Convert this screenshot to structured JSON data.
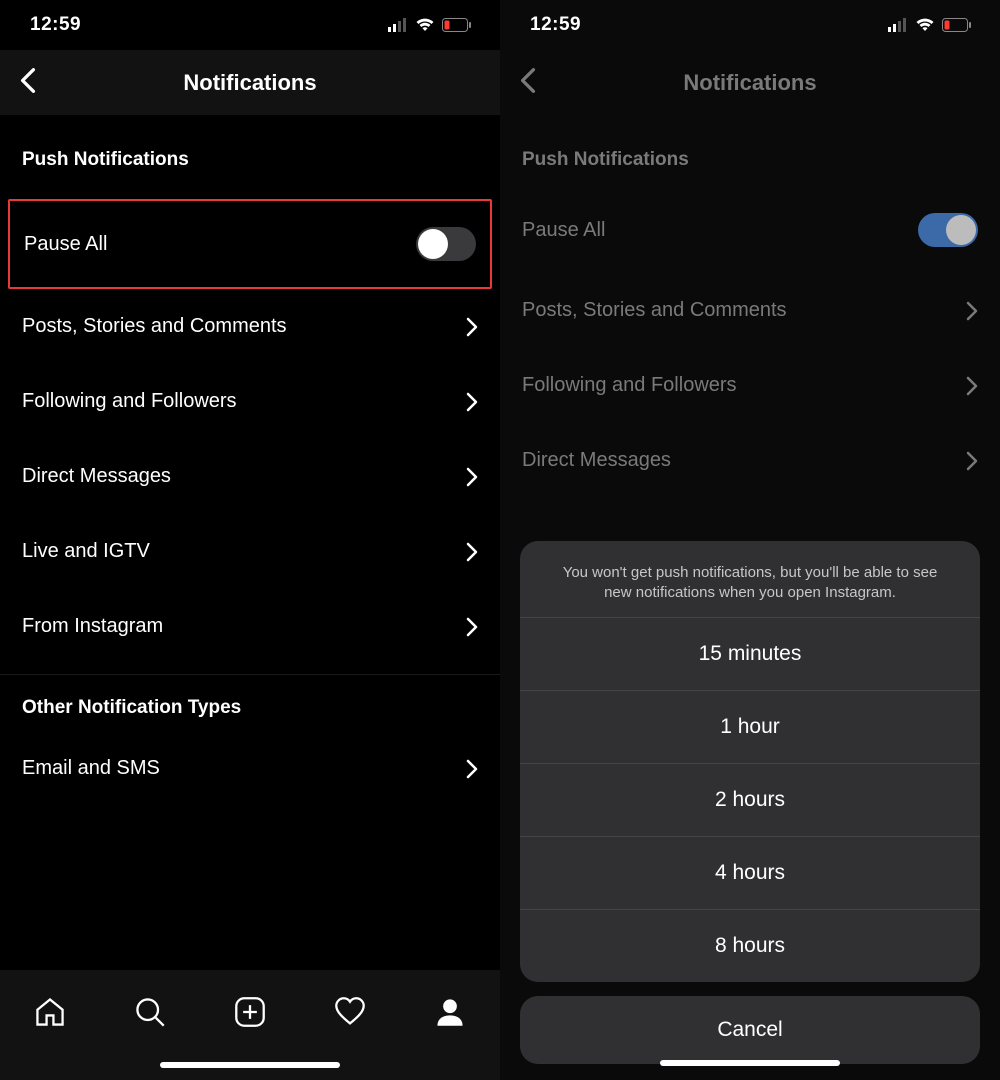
{
  "status": {
    "time": "12:59"
  },
  "header": {
    "title": "Notifications"
  },
  "sections": {
    "push_title": "Push Notifications",
    "pause_all": "Pause All",
    "rows": {
      "posts": "Posts, Stories and Comments",
      "following": "Following and Followers",
      "dm": "Direct Messages",
      "live": "Live and IGTV",
      "from_ig": "From Instagram"
    },
    "other_title": "Other Notification Types",
    "email_sms": "Email and SMS"
  },
  "sheet": {
    "message": "You won't get push notifications, but you'll be able to see new notifications when you open Instagram.",
    "opt1": "15 minutes",
    "opt2": "1 hour",
    "opt3": "2 hours",
    "opt4": "4 hours",
    "opt5": "8 hours",
    "cancel": "Cancel"
  }
}
